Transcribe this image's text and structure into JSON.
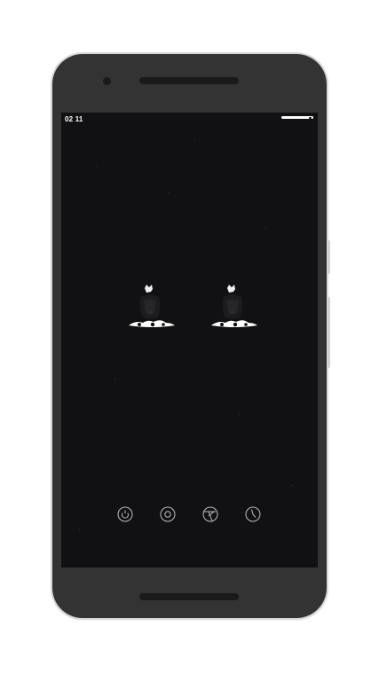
{
  "status_bar": {
    "time": "02 11"
  },
  "wallpaper": {
    "description_icons": [
      "silhouette-figure-icon",
      "silhouette-figure-icon"
    ]
  },
  "dock": {
    "icons": [
      "power-ring-icon",
      "target-ring-icon",
      "aperture-icon",
      "clock-icon"
    ]
  },
  "colors": {
    "screen_bg": "#111113",
    "bezel": "#333333",
    "icon_stroke": "#bdbdbd",
    "text": "#ffffff"
  }
}
